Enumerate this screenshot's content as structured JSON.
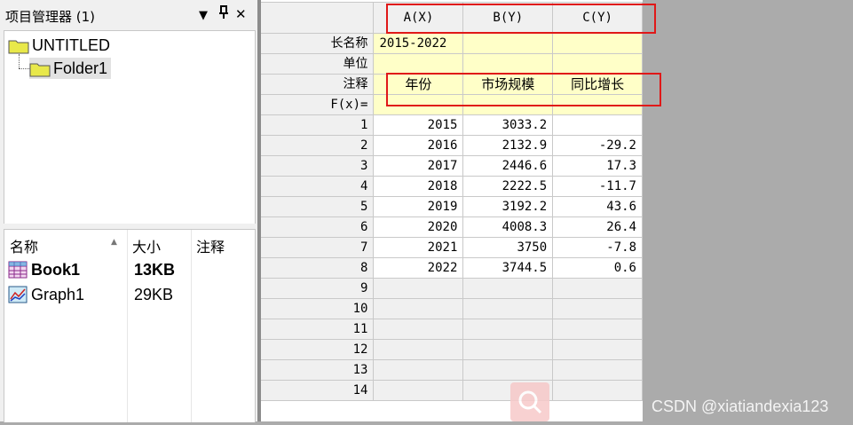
{
  "panel": {
    "title": "项目管理器 (1)",
    "controls": {
      "dropdown": "▼",
      "pin": "ᵖ",
      "close": "✕"
    },
    "tree": [
      {
        "label": "UNTITLED",
        "icon": "folder-icon"
      },
      {
        "label": "Folder1",
        "icon": "folder-icon"
      }
    ],
    "columns": {
      "name": "名称",
      "size": "大小",
      "comment": "注释"
    },
    "files": [
      {
        "name": "Book1",
        "size": "13KB",
        "icon": "workbook-icon"
      },
      {
        "name": "Graph1",
        "size": "29KB",
        "icon": "graph-icon"
      }
    ]
  },
  "sheet": {
    "columns": [
      "A(X)",
      "B(Y)",
      "C(Y)"
    ],
    "meta_labels": {
      "longname": "长名称",
      "units": "单位",
      "comments": "注释",
      "fx": "F(x)="
    },
    "longname": [
      "2015-2022",
      "",
      ""
    ],
    "units": [
      "",
      "",
      ""
    ],
    "comments": [
      "年份",
      "市场规模",
      "同比增长"
    ],
    "rows": [
      {
        "n": "1",
        "a": "2015",
        "b": "3033.2",
        "c": ""
      },
      {
        "n": "2",
        "a": "2016",
        "b": "2132.9",
        "c": "-29.2"
      },
      {
        "n": "3",
        "a": "2017",
        "b": "2446.6",
        "c": "17.3"
      },
      {
        "n": "4",
        "a": "2018",
        "b": "2222.5",
        "c": "-11.7"
      },
      {
        "n": "5",
        "a": "2019",
        "b": "3192.2",
        "c": "43.6"
      },
      {
        "n": "6",
        "a": "2020",
        "b": "4008.3",
        "c": "26.4"
      },
      {
        "n": "7",
        "a": "2021",
        "b": "3750",
        "c": "-7.8"
      },
      {
        "n": "8",
        "a": "2022",
        "b": "3744.5",
        "c": "0.6"
      }
    ],
    "empty_rows": [
      "9",
      "10",
      "11",
      "12",
      "13",
      "14"
    ]
  },
  "watermark": "CSDN @xiatiandexia123",
  "colors": {
    "meta_fill": "#ffffc8",
    "annotation": "#e01818",
    "header_fill": "#f0f0f0"
  }
}
